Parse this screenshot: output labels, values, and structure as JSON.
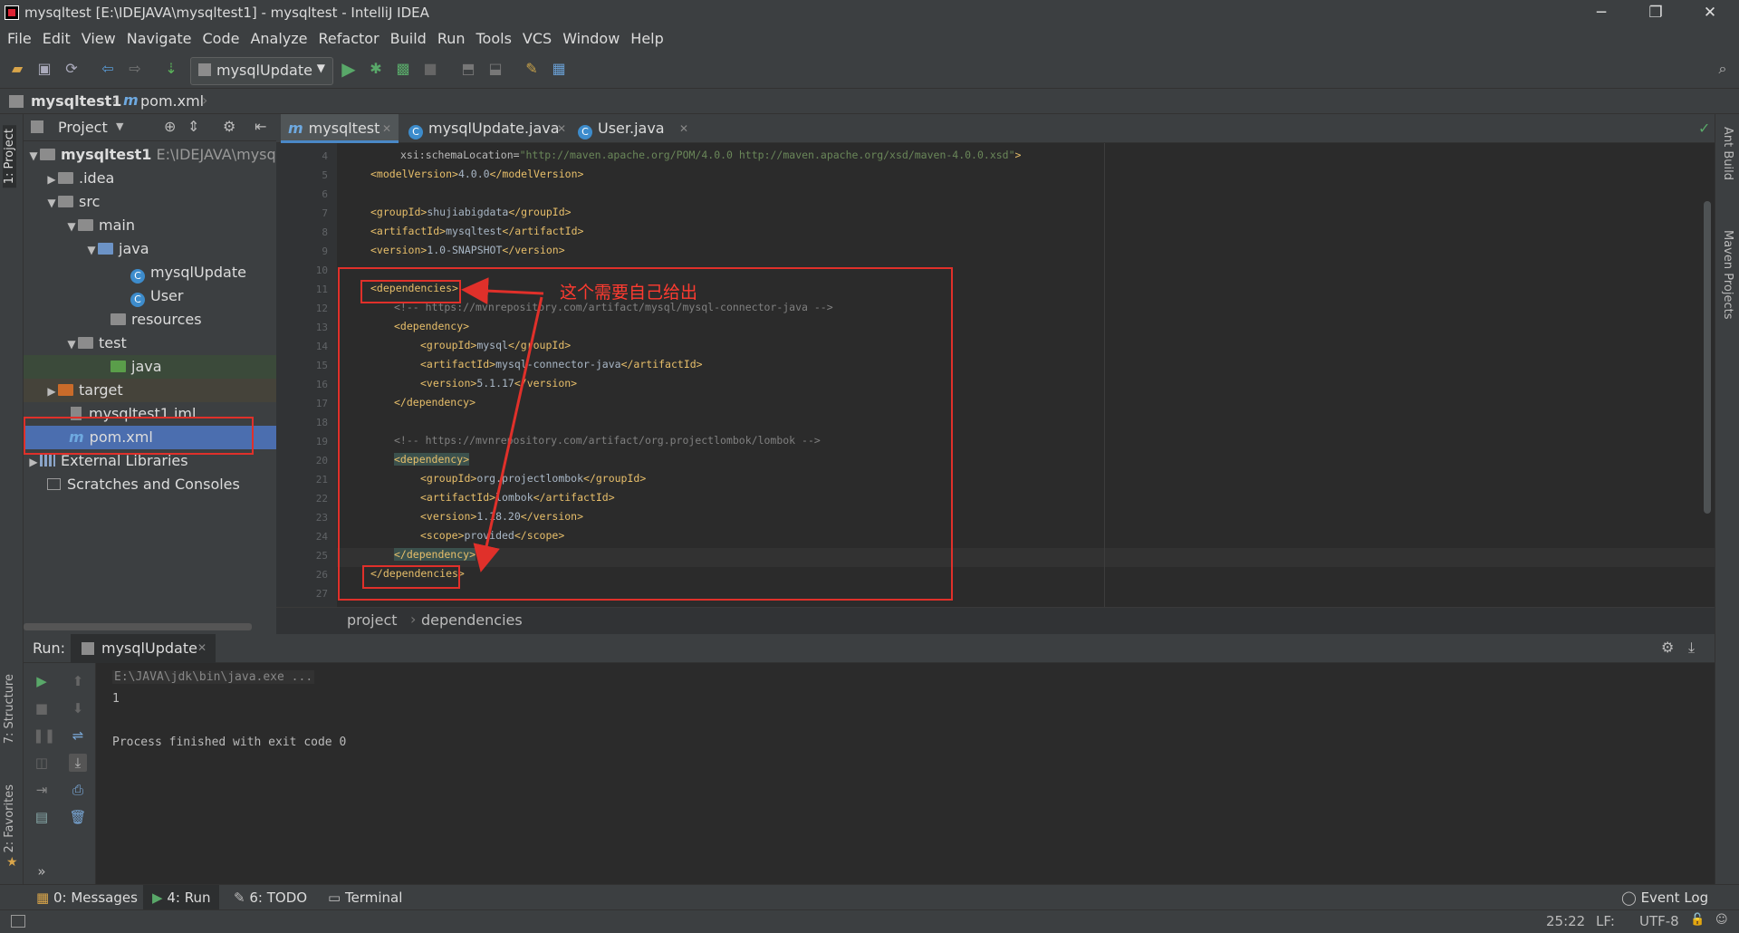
{
  "window": {
    "title": "mysqltest [E:\\IDEJAVA\\mysqltest1] - mysqltest - IntelliJ IDEA",
    "minimize": "─",
    "restore": "❐",
    "close": "✕"
  },
  "menu": [
    "File",
    "Edit",
    "View",
    "Navigate",
    "Code",
    "Analyze",
    "Refactor",
    "Build",
    "Run",
    "Tools",
    "VCS",
    "Window",
    "Help"
  ],
  "toolbar": {
    "run_config": "mysqlUpdate"
  },
  "navbar": {
    "project": "mysqltest1",
    "file": "pom.xml"
  },
  "side_tabs": {
    "project": "1: Project",
    "structure": "7: Structure",
    "favorites": "2: Favorites",
    "ant_build": "Ant Build",
    "maven_projects": "Maven Projects"
  },
  "project_panel": {
    "title": "Project",
    "tree": [
      {
        "label": "mysqltest1",
        "path": "E:\\IDEJAVA\\mysqlte"
      },
      {
        "label": ".idea"
      },
      {
        "label": "src"
      },
      {
        "label": "main"
      },
      {
        "label": "java"
      },
      {
        "label": "mysqlUpdate"
      },
      {
        "label": "User"
      },
      {
        "label": "resources"
      },
      {
        "label": "test"
      },
      {
        "label": "java"
      },
      {
        "label": "target"
      },
      {
        "label": "mysqltest1.iml"
      },
      {
        "label": "pom.xml"
      },
      {
        "label": "External Libraries"
      },
      {
        "label": "Scratches and Consoles"
      }
    ]
  },
  "editor": {
    "tabs": [
      "mysqltest",
      "mysqlUpdate.java",
      "User.java"
    ],
    "line_numbers": [
      "4",
      "5",
      "6",
      "7",
      "8",
      "9",
      "10",
      "11",
      "12",
      "13",
      "14",
      "15",
      "16",
      "17",
      "18",
      "19",
      "20",
      "21",
      "22",
      "23",
      "24",
      "25",
      "26",
      "27"
    ],
    "lines": {
      "l4_attr": "xsi:schemaLocation=",
      "l4_str": "\"http://maven.apache.org/POM/4.0.0 http://maven.apache.org/xsd/maven-4.0.0.xsd\"",
      "l4_close": ">",
      "l5_open": "<modelVersion>",
      "l5_val": "4.0.0",
      "l5_close": "</modelVersion>",
      "l7_open": "<groupId>",
      "l7_val": "shujiabigdata",
      "l7_close": "</groupId>",
      "l8_open": "<artifactId>",
      "l8_val": "mysqltest",
      "l8_close": "</artifactId>",
      "l9_open": "<version>",
      "l9_val": "1.0-SNAPSHOT",
      "l9_close": "</version>",
      "l11": "<dependencies>",
      "l12": "<!-- https://mvnrepository.com/artifact/mysql/mysql-connector-java -->",
      "l13": "<dependency>",
      "l14_open": "<groupId>",
      "l14_val": "mysql",
      "l14_close": "</groupId>",
      "l15_open": "<artifactId>",
      "l15_val": "mysql-connector-java",
      "l15_close": "</artifactId>",
      "l16_open": "<version>",
      "l16_val": "5.1.17",
      "l16_close": "</version>",
      "l17": "</dependency>",
      "l19": "<!-- https://mvnrepository.com/artifact/org.projectlombok/lombok -->",
      "l20": "<dependency>",
      "l21_open": "<groupId>",
      "l21_val": "org.projectlombok",
      "l21_close": "</groupId>",
      "l22_open": "<artifactId>",
      "l22_val": "lombok",
      "l22_close": "</artifactId>",
      "l23_open": "<version>",
      "l23_val": "1.18.20",
      "l23_close": "</version>",
      "l24_open": "<scope>",
      "l24_val": "provided",
      "l24_close": "</scope>",
      "l25": "</dependency>",
      "l26": "</dependencies>"
    },
    "breadcrumb": [
      "project",
      "dependencies"
    ]
  },
  "annotation": {
    "text": "这个需要自己给出"
  },
  "run_panel": {
    "label": "Run:",
    "tab": "mysqlUpdate",
    "console": [
      "E:\\JAVA\\jdk\\bin\\java.exe ...",
      "1",
      "",
      "Process finished with exit code 0"
    ]
  },
  "bottom_tools": [
    {
      "label": "0: Messages"
    },
    {
      "label": "4: Run"
    },
    {
      "label": "6: TODO"
    },
    {
      "label": "Terminal"
    }
  ],
  "event_log": "Event Log",
  "status": {
    "position": "25:22",
    "line_sep": "LF:",
    "encoding": "UTF-8"
  },
  "colors": {
    "accent": "#4a88c7",
    "annotation_red": "#e0302a",
    "tag": "#e8bf6a",
    "string": "#6a8759",
    "comment": "#808080"
  }
}
